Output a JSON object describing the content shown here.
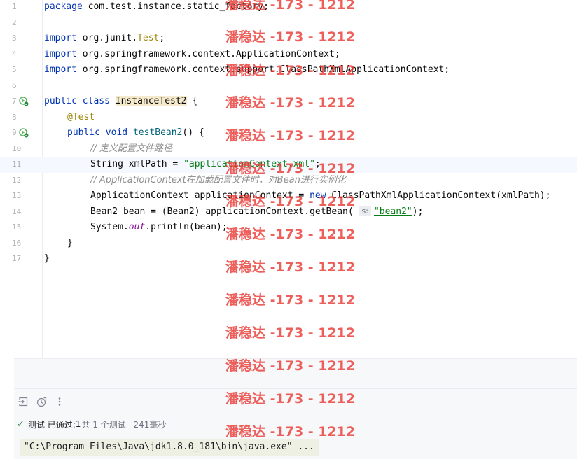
{
  "editor": {
    "line_numbers": [
      "1",
      "2",
      "3",
      "4",
      "5",
      "6",
      "7",
      "8",
      "9",
      "10",
      "11",
      "12",
      "13",
      "14",
      "15",
      "16",
      "17"
    ],
    "lines": {
      "l1": {
        "kw": "package",
        "rest": " com.test.instance.static_factory;"
      },
      "l3": {
        "kw": "import",
        "pkg": " org.junit.",
        "cls": "Test",
        "end": ";"
      },
      "l4": {
        "kw": "import",
        "rest": " org.springframework.context.ApplicationContext;"
      },
      "l5": {
        "kw": "import",
        "rest": " org.springframework.context.support.ClassPathXmlApplicationContext;"
      },
      "l7": {
        "kw1": "public",
        "kw2": "class",
        "cls": "InstanceTest2",
        "end": " {"
      },
      "l8": {
        "ann": "@Test"
      },
      "l9": {
        "kw1": "public",
        "kw2": "void",
        "method": "testBean2",
        "end": "() {"
      },
      "l10": {
        "comment": "// 定义配置文件路径"
      },
      "l11": {
        "pre": "String xmlPath = ",
        "str": "\"applicationContext.xml\"",
        "end": ";"
      },
      "l12": {
        "comment": "// ApplicationContext在加载配置文件时，对Bean进行实例化"
      },
      "l13": {
        "pre": "ApplicationContext applicationContext = ",
        "kw": "new",
        "end": " ClassPathXmlApplicationContext(xmlPath);"
      },
      "l14": {
        "pre": "Bean2 bean = (Bean2) applicationContext.getBean( ",
        "hint": "s:",
        "str": "\"bean2\"",
        "end": ");"
      },
      "l15": {
        "pre": "System.",
        "field": "out",
        "end": ".println(bean);"
      },
      "l16": {
        "text": "}"
      },
      "l17": {
        "text": "}"
      }
    }
  },
  "test_window": {
    "status_label": "测试 已通过: ",
    "passed_count": "1",
    "total_text": "共 1 个测试",
    "duration": " – 241毫秒",
    "console_line": "\"C:\\Program Files\\Java\\jdk1.8.0_181\\bin\\java.exe\" ...",
    "toolbar_icons": [
      "import-tests-icon",
      "clock-history-icon",
      "more-options-icon"
    ]
  },
  "watermark": {
    "text": "潘稳达 -173 - 1212"
  },
  "colors": {
    "keyword": "#0033b3",
    "string": "#067d17",
    "annotation": "#9e880d",
    "comment": "#8c8c8c",
    "success": "#208a3c",
    "watermark": "#e93c37"
  }
}
